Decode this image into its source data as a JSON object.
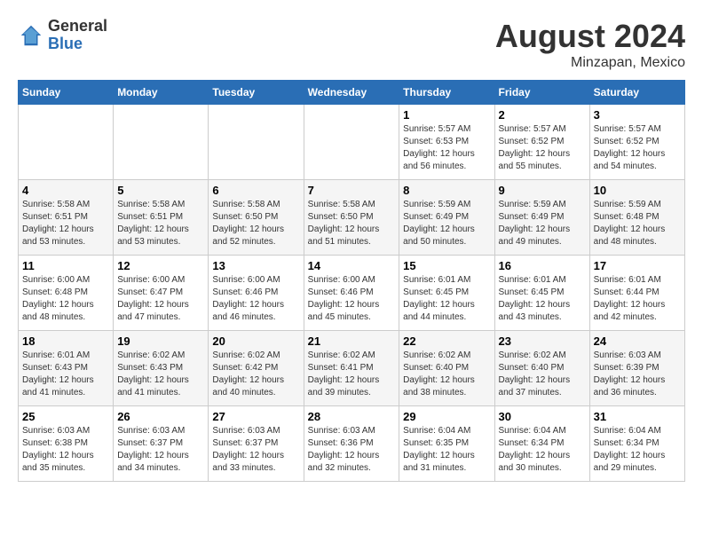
{
  "logo": {
    "general": "General",
    "blue": "Blue"
  },
  "title": {
    "month_year": "August 2024",
    "location": "Minzapan, Mexico"
  },
  "days_of_week": [
    "Sunday",
    "Monday",
    "Tuesday",
    "Wednesday",
    "Thursday",
    "Friday",
    "Saturday"
  ],
  "weeks": [
    [
      {
        "day": "",
        "info": ""
      },
      {
        "day": "",
        "info": ""
      },
      {
        "day": "",
        "info": ""
      },
      {
        "day": "",
        "info": ""
      },
      {
        "day": "1",
        "info": "Sunrise: 5:57 AM\nSunset: 6:53 PM\nDaylight: 12 hours\nand 56 minutes."
      },
      {
        "day": "2",
        "info": "Sunrise: 5:57 AM\nSunset: 6:52 PM\nDaylight: 12 hours\nand 55 minutes."
      },
      {
        "day": "3",
        "info": "Sunrise: 5:57 AM\nSunset: 6:52 PM\nDaylight: 12 hours\nand 54 minutes."
      }
    ],
    [
      {
        "day": "4",
        "info": "Sunrise: 5:58 AM\nSunset: 6:51 PM\nDaylight: 12 hours\nand 53 minutes."
      },
      {
        "day": "5",
        "info": "Sunrise: 5:58 AM\nSunset: 6:51 PM\nDaylight: 12 hours\nand 53 minutes."
      },
      {
        "day": "6",
        "info": "Sunrise: 5:58 AM\nSunset: 6:50 PM\nDaylight: 12 hours\nand 52 minutes."
      },
      {
        "day": "7",
        "info": "Sunrise: 5:58 AM\nSunset: 6:50 PM\nDaylight: 12 hours\nand 51 minutes."
      },
      {
        "day": "8",
        "info": "Sunrise: 5:59 AM\nSunset: 6:49 PM\nDaylight: 12 hours\nand 50 minutes."
      },
      {
        "day": "9",
        "info": "Sunrise: 5:59 AM\nSunset: 6:49 PM\nDaylight: 12 hours\nand 49 minutes."
      },
      {
        "day": "10",
        "info": "Sunrise: 5:59 AM\nSunset: 6:48 PM\nDaylight: 12 hours\nand 48 minutes."
      }
    ],
    [
      {
        "day": "11",
        "info": "Sunrise: 6:00 AM\nSunset: 6:48 PM\nDaylight: 12 hours\nand 48 minutes."
      },
      {
        "day": "12",
        "info": "Sunrise: 6:00 AM\nSunset: 6:47 PM\nDaylight: 12 hours\nand 47 minutes."
      },
      {
        "day": "13",
        "info": "Sunrise: 6:00 AM\nSunset: 6:46 PM\nDaylight: 12 hours\nand 46 minutes."
      },
      {
        "day": "14",
        "info": "Sunrise: 6:00 AM\nSunset: 6:46 PM\nDaylight: 12 hours\nand 45 minutes."
      },
      {
        "day": "15",
        "info": "Sunrise: 6:01 AM\nSunset: 6:45 PM\nDaylight: 12 hours\nand 44 minutes."
      },
      {
        "day": "16",
        "info": "Sunrise: 6:01 AM\nSunset: 6:45 PM\nDaylight: 12 hours\nand 43 minutes."
      },
      {
        "day": "17",
        "info": "Sunrise: 6:01 AM\nSunset: 6:44 PM\nDaylight: 12 hours\nand 42 minutes."
      }
    ],
    [
      {
        "day": "18",
        "info": "Sunrise: 6:01 AM\nSunset: 6:43 PM\nDaylight: 12 hours\nand 41 minutes."
      },
      {
        "day": "19",
        "info": "Sunrise: 6:02 AM\nSunset: 6:43 PM\nDaylight: 12 hours\nand 41 minutes."
      },
      {
        "day": "20",
        "info": "Sunrise: 6:02 AM\nSunset: 6:42 PM\nDaylight: 12 hours\nand 40 minutes."
      },
      {
        "day": "21",
        "info": "Sunrise: 6:02 AM\nSunset: 6:41 PM\nDaylight: 12 hours\nand 39 minutes."
      },
      {
        "day": "22",
        "info": "Sunrise: 6:02 AM\nSunset: 6:40 PM\nDaylight: 12 hours\nand 38 minutes."
      },
      {
        "day": "23",
        "info": "Sunrise: 6:02 AM\nSunset: 6:40 PM\nDaylight: 12 hours\nand 37 minutes."
      },
      {
        "day": "24",
        "info": "Sunrise: 6:03 AM\nSunset: 6:39 PM\nDaylight: 12 hours\nand 36 minutes."
      }
    ],
    [
      {
        "day": "25",
        "info": "Sunrise: 6:03 AM\nSunset: 6:38 PM\nDaylight: 12 hours\nand 35 minutes."
      },
      {
        "day": "26",
        "info": "Sunrise: 6:03 AM\nSunset: 6:37 PM\nDaylight: 12 hours\nand 34 minutes."
      },
      {
        "day": "27",
        "info": "Sunrise: 6:03 AM\nSunset: 6:37 PM\nDaylight: 12 hours\nand 33 minutes."
      },
      {
        "day": "28",
        "info": "Sunrise: 6:03 AM\nSunset: 6:36 PM\nDaylight: 12 hours\nand 32 minutes."
      },
      {
        "day": "29",
        "info": "Sunrise: 6:04 AM\nSunset: 6:35 PM\nDaylight: 12 hours\nand 31 minutes."
      },
      {
        "day": "30",
        "info": "Sunrise: 6:04 AM\nSunset: 6:34 PM\nDaylight: 12 hours\nand 30 minutes."
      },
      {
        "day": "31",
        "info": "Sunrise: 6:04 AM\nSunset: 6:34 PM\nDaylight: 12 hours\nand 29 minutes."
      }
    ]
  ]
}
